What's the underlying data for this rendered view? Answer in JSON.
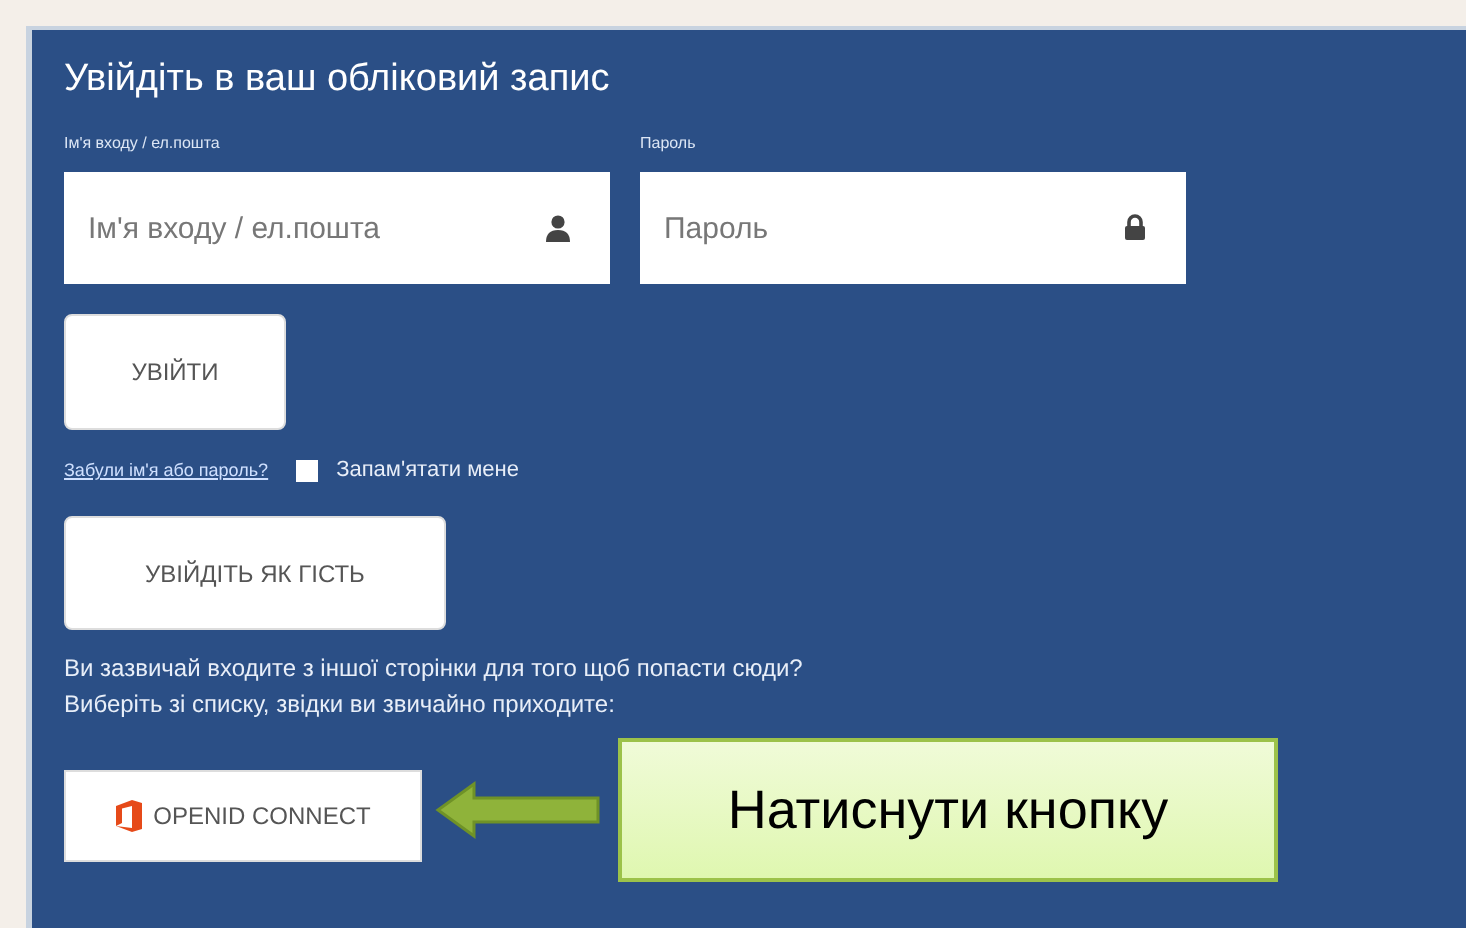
{
  "title": "Увійдіть в ваш обліковий запис",
  "username": {
    "label": "Ім'я входу / ел.пошта",
    "placeholder": "Ім'я входу / ел.пошта"
  },
  "password": {
    "label": "Пароль",
    "placeholder": "Пароль"
  },
  "login_button": "УВІЙТИ",
  "forgot_link": "Забули ім'я або пароль?",
  "remember": {
    "label": "Запам'ятати мене",
    "checked": false
  },
  "guest_button": "УВІЙДІТЬ ЯК ГІСТЬ",
  "info_lines": [
    "Ви зазвичай входите з іншої сторінки для того щоб попасти сюди?",
    "Виберіть зі списку, звідки ви звичайно приходите:"
  ],
  "openid_button": "OPENID CONNECT",
  "callout": "Натиснути кнопку"
}
